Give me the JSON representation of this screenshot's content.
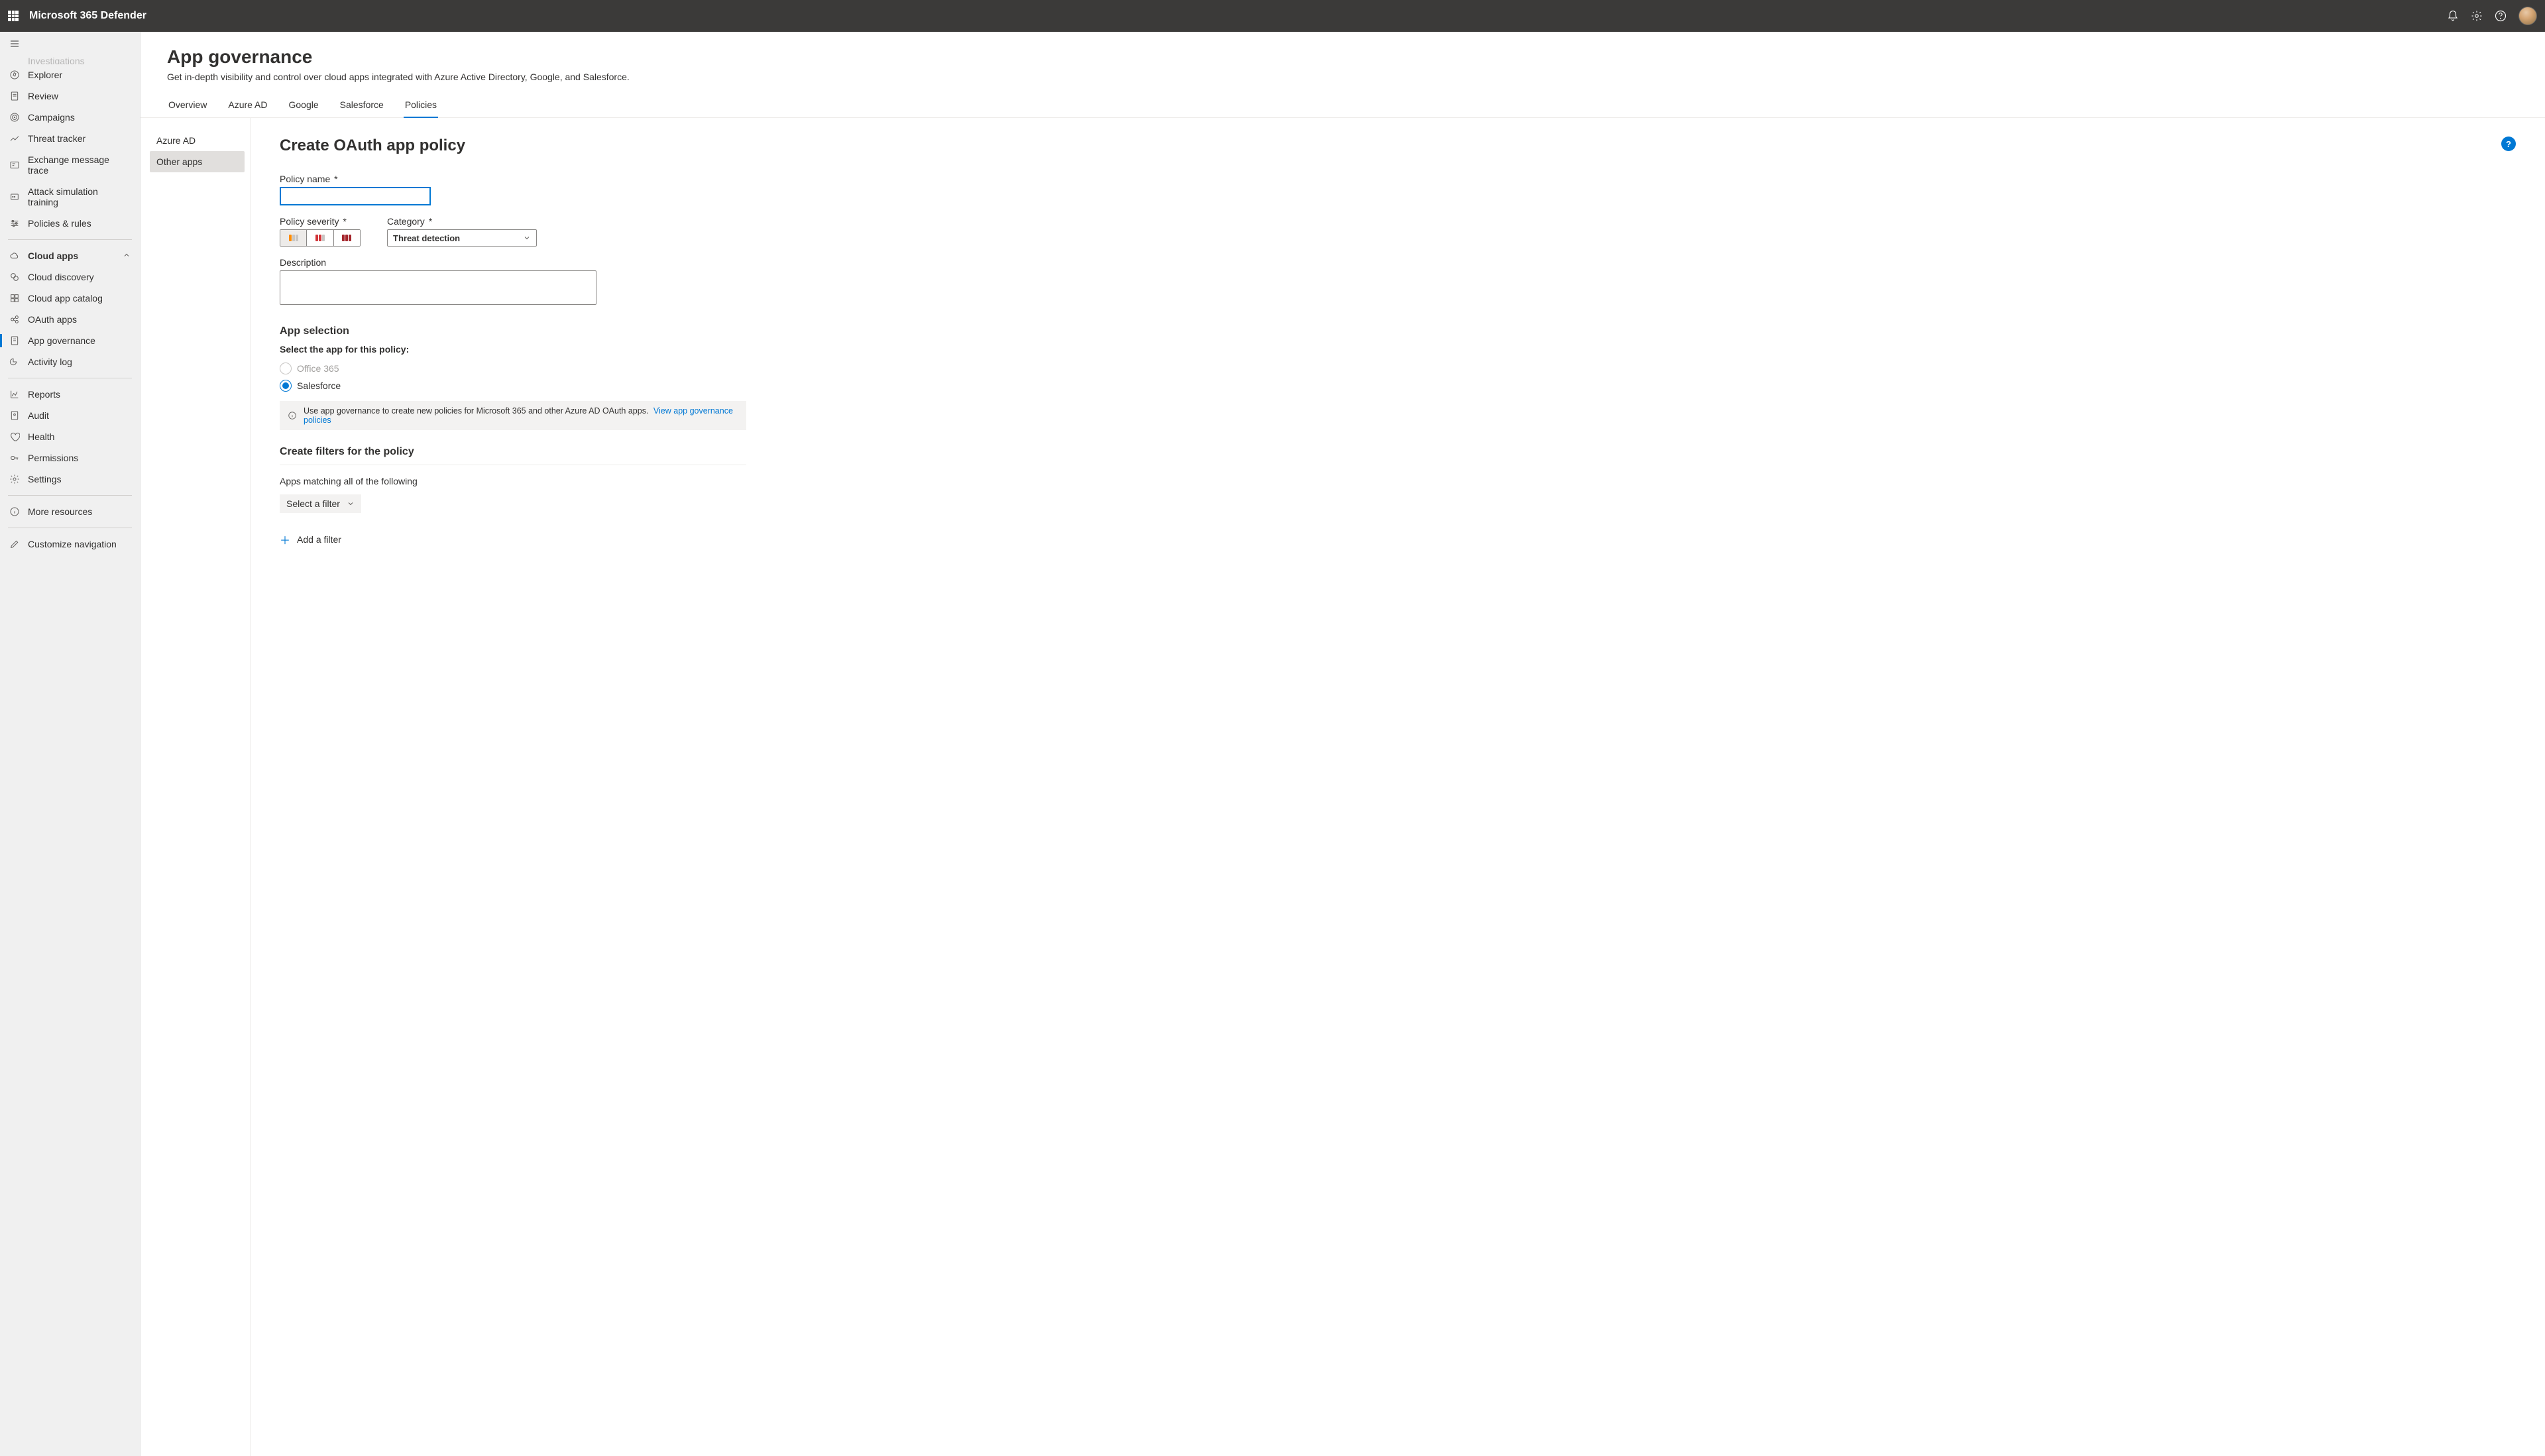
{
  "header": {
    "product_name": "Microsoft 365 Defender"
  },
  "sidebar": {
    "truncated_item": "Investigations",
    "items_top": [
      {
        "label": "Explorer",
        "icon": "explorer"
      },
      {
        "label": "Review",
        "icon": "review"
      },
      {
        "label": "Campaigns",
        "icon": "campaigns"
      },
      {
        "label": "Threat tracker",
        "icon": "tracker"
      },
      {
        "label": "Exchange message trace",
        "icon": "exchange"
      },
      {
        "label": "Attack simulation training",
        "icon": "attack"
      },
      {
        "label": "Policies & rules",
        "icon": "policies"
      }
    ],
    "cloud_section": {
      "header": "Cloud apps",
      "items": [
        {
          "label": "Cloud discovery"
        },
        {
          "label": "Cloud app catalog"
        },
        {
          "label": "OAuth apps"
        },
        {
          "label": "App governance",
          "active": true
        },
        {
          "label": "Activity log"
        }
      ]
    },
    "items_bottom": [
      {
        "label": "Reports",
        "icon": "reports"
      },
      {
        "label": "Audit",
        "icon": "audit"
      },
      {
        "label": "Health",
        "icon": "health"
      },
      {
        "label": "Permissions",
        "icon": "permissions"
      },
      {
        "label": "Settings",
        "icon": "settings"
      }
    ],
    "more_resources": "More resources",
    "customize": "Customize navigation"
  },
  "page": {
    "title": "App governance",
    "subtitle": "Get in-depth visibility and control over cloud apps integrated with Azure Active Directory, Google, and Salesforce.",
    "tabs": [
      "Overview",
      "Azure AD",
      "Google",
      "Salesforce",
      "Policies"
    ],
    "active_tab": "Policies"
  },
  "subnav": {
    "items": [
      "Azure AD",
      "Other apps"
    ],
    "active": "Other apps"
  },
  "form": {
    "title": "Create OAuth app policy",
    "policy_name_label": "Policy name",
    "policy_name_value": "",
    "policy_severity_label": "Policy severity",
    "category_label": "Category",
    "category_value": "Threat detection",
    "description_label": "Description",
    "description_value": "",
    "app_selection_heading": "App selection",
    "app_selection_prompt": "Select the app for this policy:",
    "app_options": [
      {
        "label": "Office 365",
        "disabled": true,
        "selected": false
      },
      {
        "label": "Salesforce",
        "disabled": false,
        "selected": true
      }
    ],
    "info_text": "Use app governance to create new policies for Microsoft 365 and other Azure AD OAuth apps.",
    "info_link": "View app governance policies",
    "filters_heading": "Create filters for the policy",
    "filters_sub": "Apps matching all of the following",
    "filter_select_label": "Select a filter",
    "add_filter_label": "Add a filter"
  }
}
